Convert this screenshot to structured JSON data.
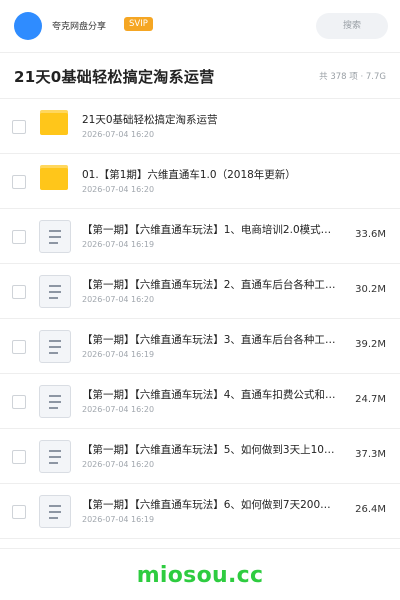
{
  "header": {
    "user_name": "夸克网盘分享",
    "badge": "SVIP",
    "search_placeholder": "搜索"
  },
  "share": {
    "title": "21天0基础轻松搞定淘系运营",
    "meta": "共 378 项 · 7.7G"
  },
  "items": [
    {
      "type": "folder",
      "icon": "folder-icon",
      "name": "21天0基础轻松搞定淘系运营",
      "date": "2026-07-04 16:20",
      "size": ""
    },
    {
      "type": "folder",
      "icon": "folder-icon",
      "name": "01.【第1期】六维直通车1.0（2018年更新）",
      "date": "2026-07-04 16:20",
      "size": ""
    },
    {
      "type": "file",
      "icon": "document-icon",
      "name": "【第一期】【六维直通车玩法】1、电商培训2.0模式…",
      "date": "2026-07-04 16:19",
      "size": "33.6M"
    },
    {
      "type": "file",
      "icon": "document-icon",
      "name": "【第一期】【六维直通车玩法】2、直通车后台各种工具…",
      "date": "2026-07-04 16:20",
      "size": "30.2M"
    },
    {
      "type": "file",
      "icon": "document-icon",
      "name": "【第一期】【六维直通车玩法】3、直通车后台各种工具…",
      "date": "2026-07-04 16:19",
      "size": "39.2M"
    },
    {
      "type": "file",
      "icon": "document-icon",
      "name": "【第一期】【六维直通车玩法】4、直通车扣费公式和质…",
      "date": "2026-07-04 16:20",
      "size": "24.7M"
    },
    {
      "type": "file",
      "icon": "document-icon",
      "name": "【第一期】【六维直通车玩法】5、如何做到3天上10…",
      "date": "2026-07-04 16:20",
      "size": "37.3M"
    },
    {
      "type": "file",
      "icon": "document-icon",
      "name": "【第一期】【六维直通车玩法】6、如何做到7天200…",
      "date": "2026-07-04 16:19",
      "size": "26.4M"
    }
  ],
  "watermark": "miosou.cc",
  "colors": {
    "accent": "#2f8cff",
    "svip": "#f5a623",
    "folder": "#ffc61a",
    "watermark": "#2ecc40"
  }
}
